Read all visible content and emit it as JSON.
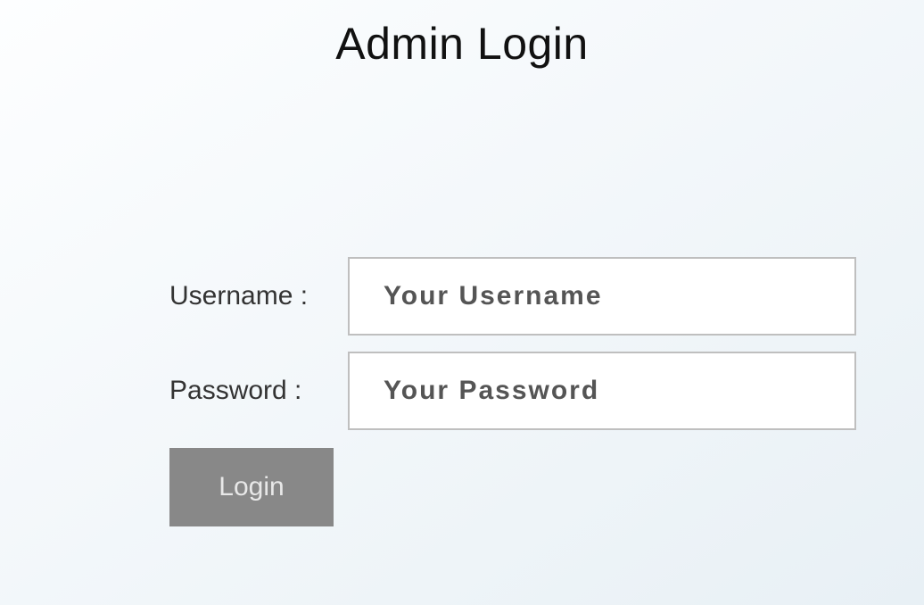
{
  "page": {
    "title": "Admin Login"
  },
  "form": {
    "username": {
      "label": "Username :",
      "placeholder": "Your Username",
      "value": ""
    },
    "password": {
      "label": "Password :",
      "placeholder": "Your Password",
      "value": ""
    },
    "submit_label": "Login"
  }
}
